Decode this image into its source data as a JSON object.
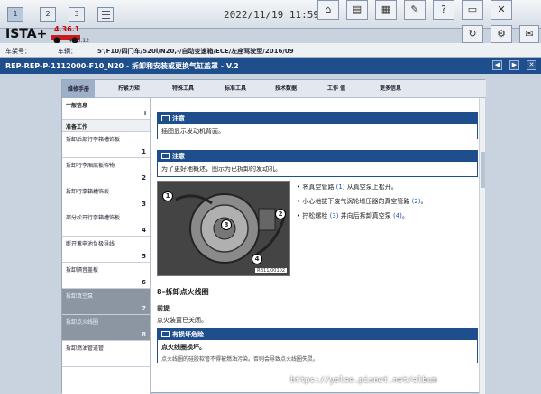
{
  "topbar": {
    "tabs": [
      "1",
      "2",
      "3"
    ],
    "datetime": "2022/11/19 11:59:25",
    "buttons": [
      "home-icon",
      "book-icon",
      "dictionary-icon",
      "wrench-icon",
      "help-icon",
      "minimize-icon",
      "close-icon"
    ]
  },
  "logo": {
    "name": "ISTA+",
    "version_large": "4.36.1",
    "version_small": "4.36.12"
  },
  "vehicle": {
    "vin_label": "车架号：",
    "vehicle_label": "车辆：",
    "info": "5'/F10/四门车/520i/N20,-/自动变速箱/ECE/左座驾驶型/2016/09"
  },
  "title": {
    "text": "REP-REP-P-1112000-F10_N20 - 拆卸和安装或更换气缸盖罩 - V.2"
  },
  "tabs": [
    "维修手册",
    "拧紧力矩",
    "特殊工具",
    "标准工具",
    "技术数据",
    "工作 值",
    "更多信息"
  ],
  "left_list": {
    "header": {
      "label": "一般信息",
      "num": "i"
    },
    "section": "准备工作",
    "items": [
      {
        "label": "拆卸后部行李箱槽饰板",
        "num": "1"
      },
      {
        "label": "拆卸行李厢底板饰物",
        "num": "2"
      },
      {
        "label": "拆卸行李箱槽饰板",
        "num": "3"
      },
      {
        "label": "部分松开行李箱槽饰板",
        "num": "4"
      },
      {
        "label": "断开蓄电池负极导线",
        "num": "5"
      },
      {
        "label": "拆卸隔音盖板",
        "num": "6"
      },
      {
        "label": "拆卸真空泵",
        "num": "7"
      },
      {
        "label": "拆卸点火线圈",
        "num": "8"
      },
      {
        "label": "拆卸燃油管道管",
        "num": ""
      }
    ]
  },
  "notes": [
    {
      "head": "注意",
      "body": "插图显示发动机背面。"
    },
    {
      "head": "注意",
      "body": "为了更好地概述，图示为已拆卸的发动机。"
    }
  ],
  "figure": {
    "label": "RB11/00102",
    "callouts": [
      "1",
      "2",
      "3",
      "4"
    ]
  },
  "steps": [
    {
      "pre": "将真空管路 ",
      "ref": "(1)",
      "post": " 从真空泵上松开。"
    },
    {
      "pre": "小心地拔下废气涡轮增压器的真空管路 ",
      "ref": "(2)",
      "post": "。"
    },
    {
      "pre": "拧松螺栓 ",
      "ref": "(3)",
      "post": " 并向后拆卸真空泵 ",
      "ref2": "(4)",
      "post2": "。"
    }
  ],
  "section8": {
    "title": "8–拆卸点火线圈",
    "sub": "前提",
    "subtext": "点火装置已关闭。"
  },
  "danger": {
    "head": "有损坏危险",
    "body": "点火线圈损坏。",
    "body2": "点火线圈的硅胶软管不得被燃油污染。否则会导致点火线圈失灵。"
  },
  "watermark": "https://yolee.pixnet.net/album",
  "colors": {
    "accent": "#1f4e8c",
    "selected": "#8c96a3"
  }
}
